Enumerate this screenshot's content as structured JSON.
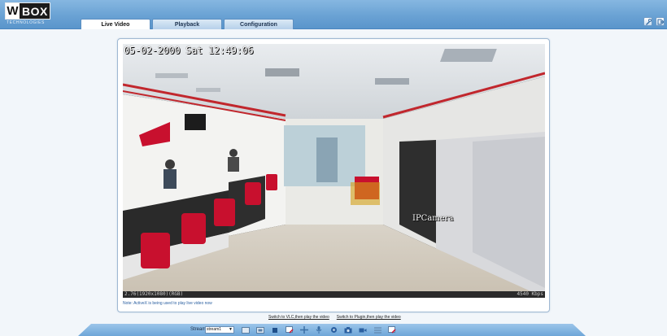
{
  "brand": {
    "logo_w": "W",
    "logo_text": "BOX",
    "logo_sub": "TECHNOLOGIES"
  },
  "tabs": [
    {
      "label": "Live Video",
      "active": true
    },
    {
      "label": "Playback",
      "active": false
    },
    {
      "label": "Configuration",
      "active": false
    }
  ],
  "header_icons": [
    "settings-icon",
    "logout-icon"
  ],
  "video": {
    "osd_time": "05-02-2000 Sat 12:49:06",
    "osd_camera": "IPCamera",
    "status_left": "2.76(1920x1080)(RGB)",
    "status_right": "4540 Kbps",
    "note": "Note: ActiveX is being used to play live video now"
  },
  "links": {
    "vlc": "Switch to VLC,then play the video",
    "plugin": "Switch to Plugin,then play the video"
  },
  "toolbar": {
    "stream_label": "Stream",
    "stream_value": "stream1",
    "tools": [
      "full-screen-icon",
      "ratio-icon",
      "stop-icon",
      "snapshot-frame-icon",
      "ptz-icon",
      "microphone-icon",
      "settings-gear-icon",
      "camera-icon",
      "record-icon",
      "grid-icon",
      "image-edit-icon"
    ]
  },
  "colors": {
    "header": "#6aa2d4",
    "accent": "#2a5fa0"
  }
}
